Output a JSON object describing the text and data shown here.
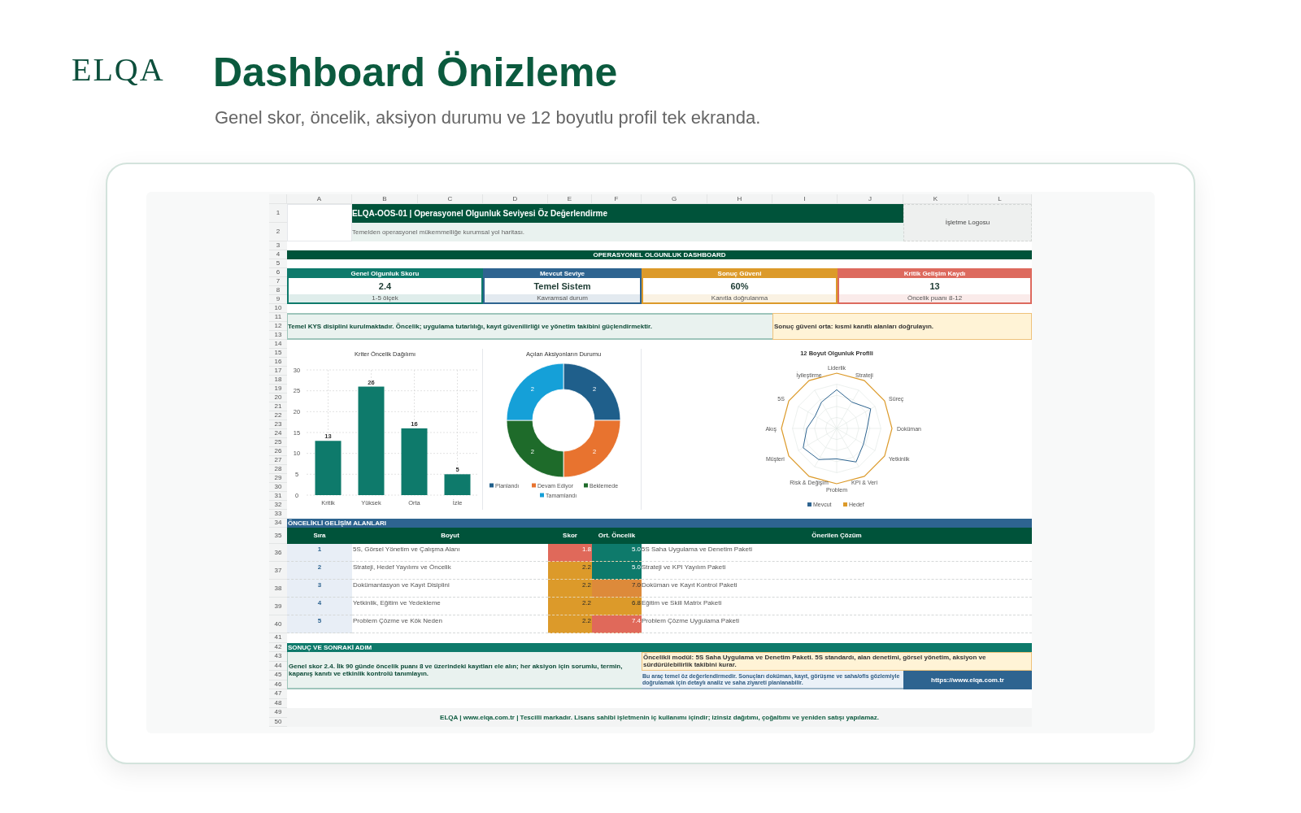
{
  "page": {
    "logo": "ELQA",
    "title": "Dashboard Önizleme",
    "subtitle": "Genel skor, öncelik, aksiyon durumu ve 12 boyutlu profil tek ekranda."
  },
  "sheet": {
    "columns": [
      "A",
      "B",
      "C",
      "D",
      "E",
      "F",
      "G",
      "H",
      "I",
      "J",
      "K",
      "L"
    ],
    "rows": [
      "1",
      "2",
      "3",
      "4",
      "5",
      "6",
      "7",
      "8",
      "9",
      "10",
      "11",
      "12",
      "13",
      "14",
      "15",
      "16",
      "17",
      "18",
      "19",
      "20",
      "21",
      "22",
      "23",
      "24",
      "25",
      "26",
      "27",
      "28",
      "29",
      "30",
      "31",
      "32",
      "33",
      "34",
      "35",
      "36",
      "37",
      "38",
      "39",
      "40",
      "41",
      "42",
      "43",
      "44",
      "45",
      "46",
      "47",
      "48",
      "49",
      "50"
    ],
    "title": "ELQA-OOS-01 | Operasyonel Olgunluk Seviyesi Öz Değerlendirme",
    "subtitle": "Temelden operasyonel mükemmelliğe kurumsal yol haritası.",
    "logo_placeholder": "İşletme Logosu",
    "banner": "OPERASYONEL OLGUNLUK DASHBOARD",
    "kpis": [
      {
        "label": "Genel Olgunluk Skoru",
        "value": "2.4",
        "note": "1-5 ölçek",
        "color": "#0e7a6b"
      },
      {
        "label": "Mevcut Seviye",
        "value": "Temel Sistem",
        "note": "Kavramsal durum",
        "color": "#2e6490"
      },
      {
        "label": "Sonuç Güveni",
        "value": "60%",
        "note": "Kanıtla doğrulanma",
        "color": "#dc9a2a"
      },
      {
        "label": "Kritik Gelişim Kaydı",
        "value": "13",
        "note": "Öncelik puanı 8-12",
        "color": "#dd6a5e"
      }
    ],
    "summary": "Temel KYS disiplini kurulmaktadır. Öncelik; uygulama tutarlılığı, kayıt güvenilirliği ve yönetim takibini güçlendirmektir.",
    "confidence_note": "Sonuç güveni orta: kısmi kanıtlı alanları doğrulayın.",
    "bar_chart": {
      "chart_data": {
        "type": "bar",
        "title": "Kriter Öncelik Dağılımı",
        "categories": [
          "Kritik",
          "Yüksek",
          "Orta",
          "İzle"
        ],
        "series": [
          {
            "color": "#0e7a6b",
            "values": [
              13,
              26,
              16,
              5
            ]
          }
        ],
        "ylim": [
          0,
          30
        ],
        "yticks": [
          0,
          5,
          10,
          15,
          20,
          25,
          30
        ],
        "grid": true,
        "data_labels": true
      }
    },
    "donut_chart": {
      "chart_data": {
        "type": "donut",
        "title": "Açılan Aksiyonların Durumu",
        "categories": [
          "Planlandı",
          "Devam Ediyor",
          "Beklemede",
          "Tamamlandı"
        ],
        "values": [
          2,
          2,
          2,
          2
        ],
        "data_labels": true,
        "legend": "bottom"
      },
      "slices": [
        {
          "color": "#1f5f8b"
        },
        {
          "color": "#e8732f"
        },
        {
          "color": "#1e6b2a"
        },
        {
          "color": "#15a0d8"
        }
      ]
    },
    "radar": {
      "title": "12 Boyut Olgunluk Profili",
      "axes": [
        "Liderlik",
        "İyileştirme",
        "Strateji",
        "5S",
        "Süreç",
        "Akış",
        "Doküman",
        "Müşteri",
        "Yetkinlik",
        "Risk & Değişim",
        "KPI & Veri",
        "Problem"
      ],
      "legend": [
        {
          "label": "Mevcut",
          "color": "#2e6490"
        },
        {
          "label": "Hedef",
          "color": "#dc9a2a"
        }
      ]
    },
    "priority": {
      "title": "ÖNCELİKLİ GELİŞİM ALANLARI",
      "columns": [
        "Sıra",
        "Boyut",
        "Skor",
        "Ort. Öncelik",
        "Önerilen Çözüm"
      ],
      "rows": [
        {
          "rank": "1",
          "dimension": "5S, Görsel Yönetim ve Çalışma Alanı",
          "score": {
            "text": "1.8",
            "color": "#e0695a"
          },
          "priority": {
            "text": "5.0",
            "color": "#0e7a6b"
          },
          "solution": "5S Saha Uygulama ve Denetim Paketi"
        },
        {
          "rank": "2",
          "dimension": "Strateji, Hedef Yayılımı ve Öncelik",
          "score": {
            "text": "2.2",
            "color": "#dc9a2a"
          },
          "priority": {
            "text": "5.0",
            "color": "#0e7a6b"
          },
          "solution": "Strateji ve KPI Yayılım Paketi"
        },
        {
          "rank": "3",
          "dimension": "Dokümantasyon ve Kayıt Disiplini",
          "score": {
            "text": "2.2",
            "color": "#dc9a2a"
          },
          "priority": {
            "text": "7.0",
            "color": "#dd8a3a"
          },
          "solution": "Doküman ve Kayıt Kontrol Paketi"
        },
        {
          "rank": "4",
          "dimension": "Yetkinlik, Eğitim ve Yedekleme",
          "score": {
            "text": "2.2",
            "color": "#dc9a2a"
          },
          "priority": {
            "text": "6.8",
            "color": "#dc9a2a"
          },
          "solution": "Eğitim ve Skill Matrix Paketi"
        },
        {
          "rank": "5",
          "dimension": "Problem Çözme ve Kök Neden",
          "score": {
            "text": "2.2",
            "color": "#dc9a2a"
          },
          "priority": {
            "text": "7.4",
            "color": "#e0695a"
          },
          "solution": "Problem Çözme Uygulama Paketi"
        }
      ]
    },
    "next_step": {
      "title": "SONUÇ VE SONRAKİ ADIM",
      "summary": "Genel skor 2.4. İlk 90 günde öncelik puanı 8 ve üzerindeki kayıtları ele alın; her aksiyon için sorumlu, termin, kapanış kanıtı ve etkinlik kontrolü tanımlayın.",
      "module_note": "Öncelikli modül: 5S Saha Uygulama ve Denetim Paketi. 5S standardı, alan denetimi, görsel yönetim, aksiyon ve sürdürülebilirlik takibini kurar.",
      "disclaimer": "Bu araç temel öz değerlendirmedir. Sonuçları doküman, kayıt, görüşme ve saha/ofis gözlemiyle doğrulamak için detaylı analiz ve saha ziyareti planlanabilir.",
      "link": "https://www.elqa.com.tr"
    },
    "footer": "ELQA | www.elqa.com.tr | Tescilli markadır. Lisans sahibi işletmenin iç kullanımı içindir; izinsiz dağıtımı, çoğaltımı ve yeniden satışı yapılamaz."
  }
}
